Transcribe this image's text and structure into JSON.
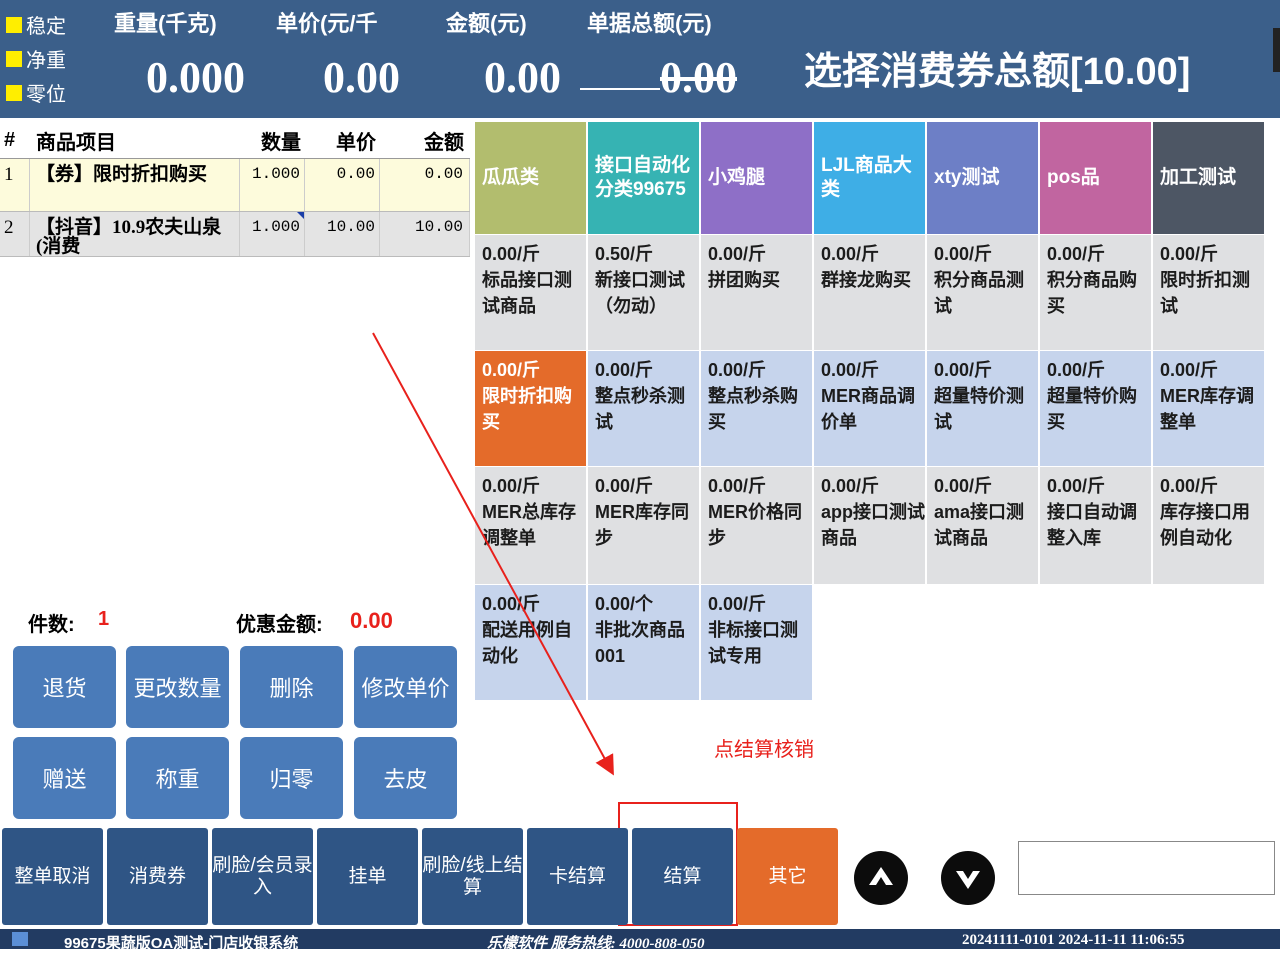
{
  "header": {
    "indicators": [
      "稳定",
      "净重",
      "零位"
    ],
    "labels": {
      "weight": "重量(千克)",
      "unit_price": "单价(元/千",
      "amount": "金额(元)",
      "total": "单据总额(元)"
    },
    "values": {
      "weight": "0.000",
      "unit_price": "0.00",
      "amount": "0.00",
      "total": "0.00"
    },
    "voucher_total": "选择消费券总额[10.00]"
  },
  "cart": {
    "columns": [
      "#",
      "商品项目",
      "数量",
      "单价",
      "金额"
    ],
    "rows": [
      {
        "no": "1",
        "name": "【券】限时折扣购买",
        "qty": "1.000",
        "price": "0.00",
        "amount": "0.00"
      },
      {
        "no": "2",
        "name": "【抖音】10.9农夫山泉(消费",
        "qty": "1.000",
        "price": "10.00",
        "amount": "10.00"
      }
    ]
  },
  "categories": [
    "瓜瓜类",
    "接口自动化分类99675",
    "小鸡腿",
    "LJL商品大类",
    "xty测试",
    "pos品",
    "加工测试"
  ],
  "category_colors": [
    "#b2bd6e",
    "#36b3b3",
    "#8e6fc7",
    "#3eaee6",
    "#6d7fc6",
    "#c165a0",
    "#4d5664"
  ],
  "products": [
    {
      "price": "0.00/斤",
      "name": "标品接口测试商品"
    },
    {
      "price": "0.50/斤",
      "name": "新接口测试（勿动）"
    },
    {
      "price": "0.00/斤",
      "name": "拼团购买"
    },
    {
      "price": "0.00/斤",
      "name": "群接龙购买"
    },
    {
      "price": "0.00/斤",
      "name": "积分商品测试"
    },
    {
      "price": "0.00/斤",
      "name": "积分商品购买"
    },
    {
      "price": "0.00/斤",
      "name": "限时折扣测试"
    },
    {
      "price": "0.00/斤",
      "name": "限时折扣购买"
    },
    {
      "price": "0.00/斤",
      "name": "整点秒杀测试"
    },
    {
      "price": "0.00/斤",
      "name": "整点秒杀购买"
    },
    {
      "price": "0.00/斤",
      "name": "MER商品调价单"
    },
    {
      "price": "0.00/斤",
      "name": "超量特价测试"
    },
    {
      "price": "0.00/斤",
      "name": "超量特价购买"
    },
    {
      "price": "0.00/斤",
      "name": "MER库存调整单"
    },
    {
      "price": "0.00/斤",
      "name": "MER总库存调整单"
    },
    {
      "price": "0.00/斤",
      "name": "MER库存同步"
    },
    {
      "price": "0.00/斤",
      "name": "MER价格同步"
    },
    {
      "price": "0.00/斤",
      "name": "app接口测试商品"
    },
    {
      "price": "0.00/斤",
      "name": "ama接口测试商品"
    },
    {
      "price": "0.00/斤",
      "name": "接口自动调整入库"
    },
    {
      "price": "0.00/斤",
      "name": "库存接口用例自动化"
    },
    {
      "price": "0.00/斤",
      "name": "配送用例自动化"
    },
    {
      "price": "0.00/个",
      "name": "非批次商品001"
    },
    {
      "price": "0.00/斤",
      "name": "非标接口测试专用"
    }
  ],
  "summary": {
    "count_label": "件数:",
    "count_value": "1",
    "discount_label": "优惠金额:",
    "discount_value": "0.00"
  },
  "actions": [
    "退货",
    "更改数量",
    "删除",
    "修改单价",
    "赠送",
    "称重",
    "归零",
    "去皮"
  ],
  "bottom_buttons": [
    "整单取消",
    "消费券",
    "刷脸/会员录入",
    "挂单",
    "刷脸/线上结算",
    "卡结算",
    "结算",
    "其它"
  ],
  "annotation": "点结算核销",
  "status": {
    "store": "99675果蔬版OA测试-门店收银系统",
    "hotline": "乐檬软件   服务热线: 4000-808-050",
    "order": "20241111-0101 2024-11-11 11:06:55"
  }
}
